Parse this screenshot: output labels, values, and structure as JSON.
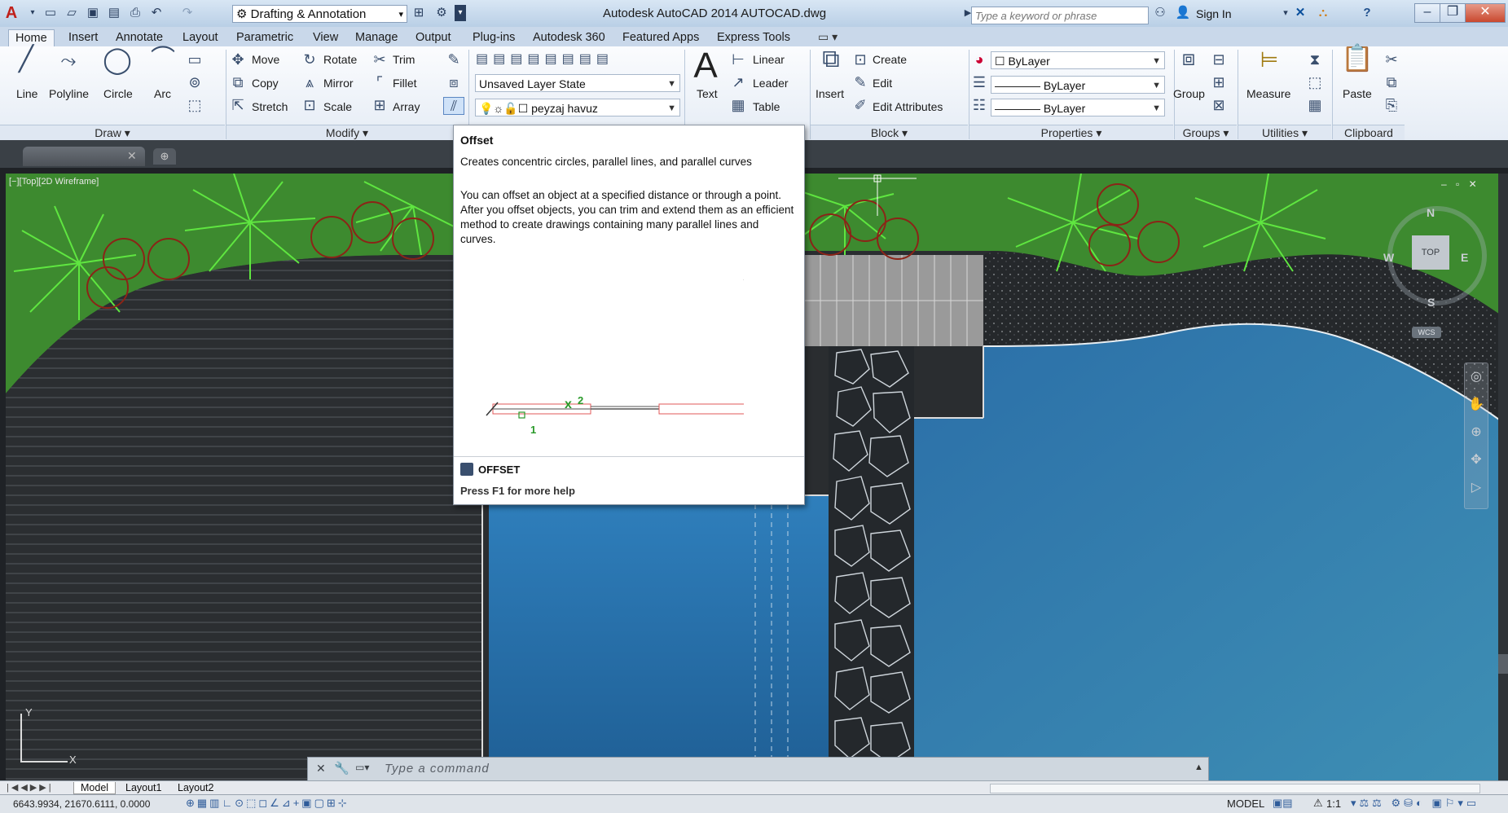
{
  "titlebar": {
    "workspace": "Drafting & Annotation",
    "app_title": "Autodesk AutoCAD 2014    AUTOCAD.dwg",
    "search_placeholder": "Type a keyword or phrase",
    "sign_in": "Sign In"
  },
  "tabs": [
    "Home",
    "Insert",
    "Annotate",
    "Layout",
    "Parametric",
    "View",
    "Manage",
    "Output",
    "Plug-ins",
    "Autodesk 360",
    "Featured Apps",
    "Express Tools"
  ],
  "ribbon": {
    "draw": {
      "line": "Line",
      "polyline": "Polyline",
      "circle": "Circle",
      "arc": "Arc",
      "title": "Draw"
    },
    "modify": {
      "move": "Move",
      "rotate": "Rotate",
      "trim": "Trim",
      "copy": "Copy",
      "mirror": "Mirror",
      "fillet": "Fillet",
      "stretch": "Stretch",
      "scale": "Scale",
      "array": "Array",
      "title": "Modify"
    },
    "layers": {
      "layer_state": "Unsaved Layer State",
      "current_layer": "peyzaj havuz"
    },
    "annotation": {
      "text": "Text",
      "linear": "Linear",
      "leader": "Leader",
      "table": "Table"
    },
    "block": {
      "insert": "Insert",
      "create": "Create",
      "edit": "Edit",
      "edit_attributes": "Edit Attributes",
      "title": "Block"
    },
    "properties": {
      "color": "ByLayer",
      "linetype": "ByLayer",
      "lineweight": "ByLayer",
      "title": "Properties"
    },
    "groups": {
      "group": "Group",
      "title": "Groups"
    },
    "utilities": {
      "measure": "Measure",
      "title": "Utilities"
    },
    "clipboard": {
      "paste": "Paste",
      "title": "Clipboard"
    }
  },
  "viewport": {
    "label": "[−][Top][2D Wireframe]",
    "viewcube": {
      "n": "N",
      "s": "S",
      "e": "E",
      "w": "W",
      "top": "TOP",
      "wcs": "WCS"
    },
    "ucs": {
      "x": "X",
      "y": "Y"
    }
  },
  "tooltip": {
    "title": "Offset",
    "summary": "Creates concentric circles, parallel lines, and parallel curves",
    "description": "You can offset an object at a specified distance or through a point. After you offset objects, you can trim and extend them as an efficient method to create drawings containing many parallel lines and curves.",
    "diagram_label_1": "1",
    "diagram_label_2": "2",
    "command": "OFFSET",
    "help": "Press F1 for more help"
  },
  "command_line": {
    "placeholder": "Type a command"
  },
  "layout_tabs": [
    "Model",
    "Layout1",
    "Layout2"
  ],
  "status": {
    "coordinates": "6643.9934, 21670.6111, 0.0000",
    "model": "MODEL",
    "scale": "1:1"
  }
}
